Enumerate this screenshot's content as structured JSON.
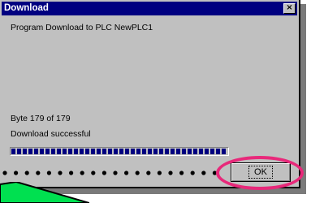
{
  "window": {
    "title": "Download",
    "close_glyph": "×"
  },
  "body": {
    "heading": "Program Download to PLC NewPLC1",
    "byte_status": "Byte 179 of 179",
    "result_status": "Download successful"
  },
  "progress": {
    "fraction": 1.0
  },
  "buttons": {
    "ok_label": "OK"
  },
  "annotation": {
    "highlight_color": "#e8287a",
    "dots_color": "#000000",
    "corner_fill": "#00e050"
  }
}
